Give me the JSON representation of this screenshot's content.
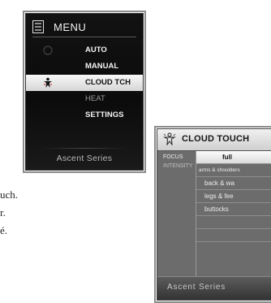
{
  "menu_screen": {
    "title": "MENU",
    "items": [
      {
        "label": "AUTO",
        "icon": "auto-icon"
      },
      {
        "label": "MANUAL",
        "icon": "none"
      },
      {
        "label": "CLOUD TCH",
        "icon": "cloud-touch-figure-icon",
        "selected": true
      },
      {
        "label": "HEAT",
        "icon": "none"
      },
      {
        "label": "SETTINGS",
        "icon": "none"
      }
    ],
    "brand": "Ascent Series"
  },
  "cloud_touch_screen": {
    "title": "CLOUD TOUCH",
    "labels": [
      "FOCUS",
      "INTENSITY"
    ],
    "options": [
      "full",
      "arms & shoulders",
      "back & wa",
      "legs & fee",
      "buttocks"
    ],
    "selected": "full",
    "brand": "Ascent Series"
  },
  "body_text": [
    "uch.",
    "r.",
    "é."
  ],
  "colors": {
    "screen_dark": "#0e0e0e",
    "screen_gray": "#6c6c6c",
    "highlight": "#e8e8e8"
  }
}
